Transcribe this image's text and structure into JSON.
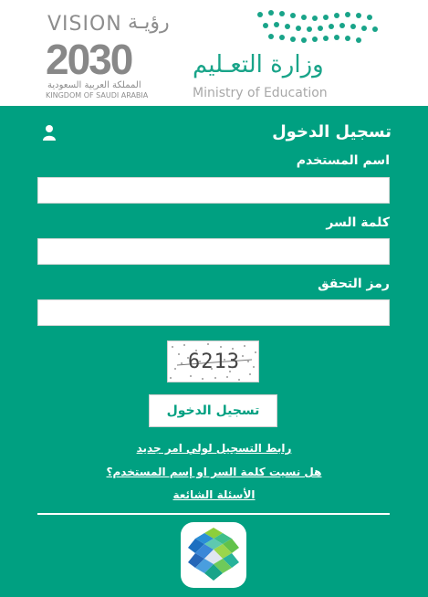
{
  "header": {
    "vision_word": "VISION",
    "vision_ar": "رؤيـة",
    "vision_year": "2030",
    "kingdom_ar": "المملكة العربية السعودية",
    "kingdom_en": "KINGDOM OF SAUDI ARABIA",
    "ministry_ar": "وزارة التعـليم",
    "ministry_en": "Ministry of Education"
  },
  "login": {
    "title": "تسجيل الدخول",
    "username_label": "اسم المستخدم",
    "username_value": "",
    "password_label": "كلمة السر",
    "password_value": "",
    "captcha_label": "رمز التحقق",
    "captcha_value": "",
    "captcha_code": "6213",
    "submit_label": "تسجيل الدخول"
  },
  "links": {
    "guardian_register": "رابط التسجيل لولي امر جديد",
    "forgot": "هل نسيت كلمة السر او إسم المستخدم؟",
    "faq": "الأسئلة الشائعة"
  },
  "colors": {
    "brand_green": "#00a081",
    "white": "#ffffff"
  }
}
